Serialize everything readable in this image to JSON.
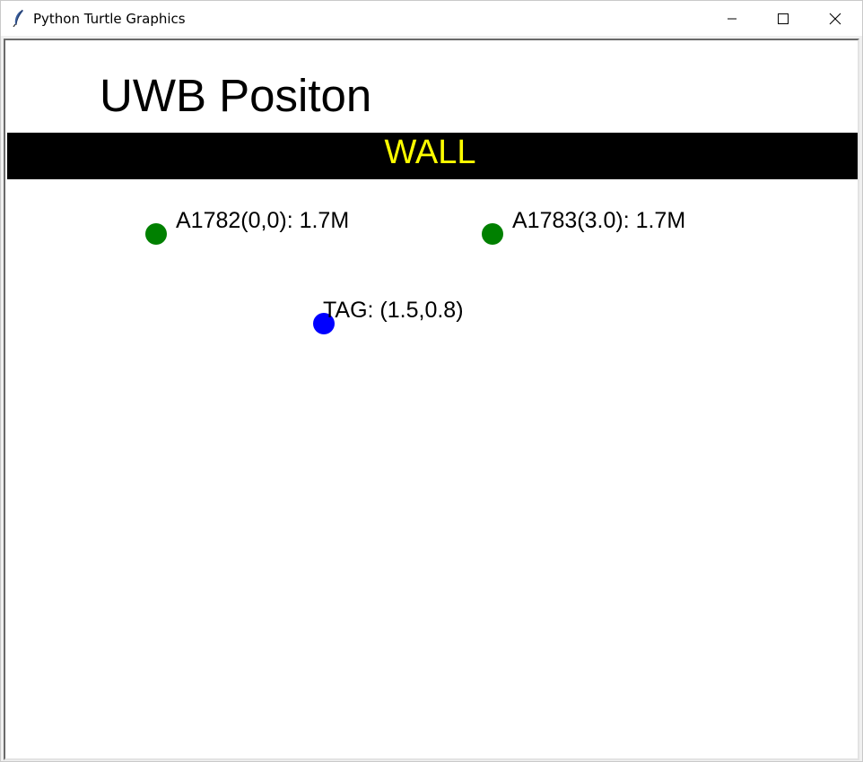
{
  "window": {
    "title": "Python Turtle Graphics",
    "app_icon": "feather-icon",
    "controls": {
      "minimize_icon": "minimize-icon",
      "maximize_icon": "maximize-icon",
      "close_icon": "close-icon"
    }
  },
  "canvas": {
    "heading": "UWB Positon",
    "wall": {
      "label": "WALL",
      "background": "#000000",
      "text_color": "#ffff00"
    },
    "anchors": [
      {
        "label": "A1782(0,0): 1.7M",
        "color": "#008000"
      },
      {
        "label": "A1783(3.0): 1.7M",
        "color": "#008000"
      }
    ],
    "tag": {
      "label": "TAG: (1.5,0.8)",
      "color": "#0000ff"
    }
  }
}
